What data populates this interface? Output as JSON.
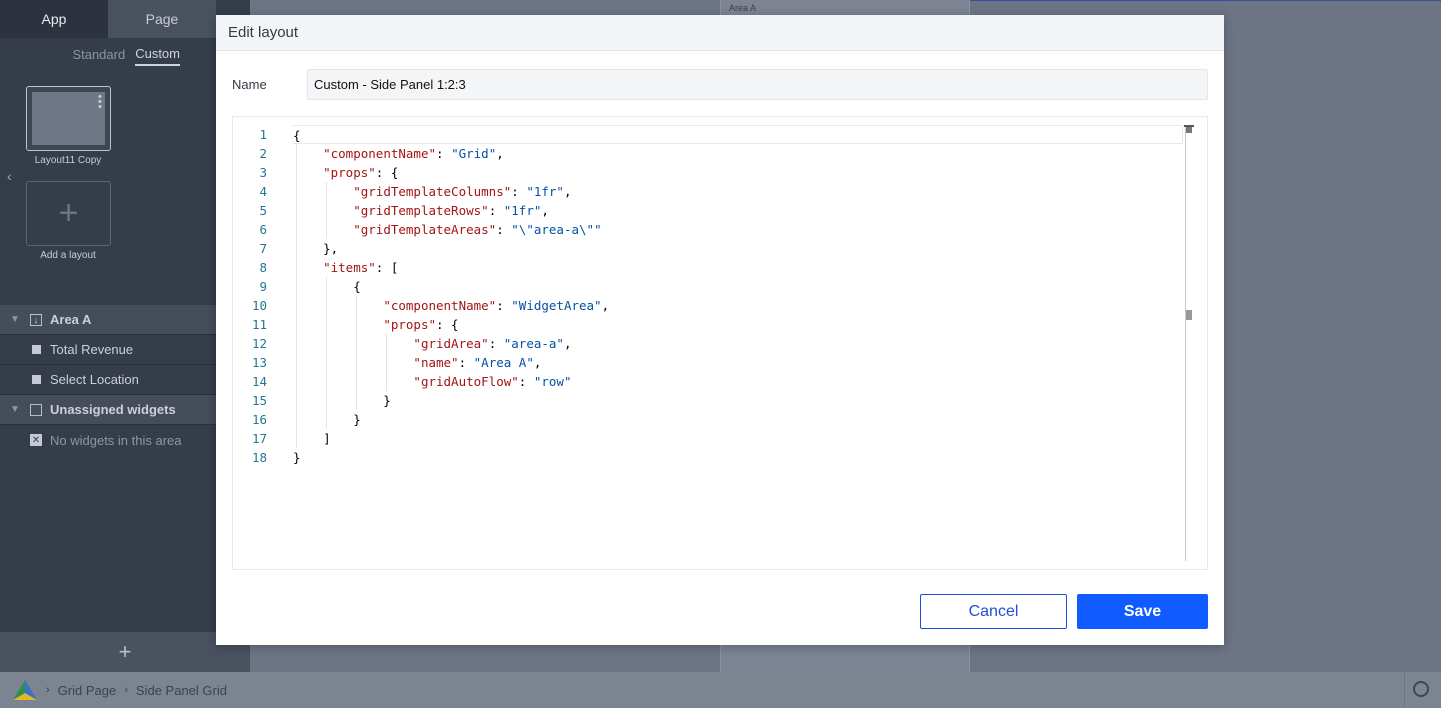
{
  "left_panel": {
    "tabs": [
      {
        "label": "App"
      },
      {
        "label": "Page"
      }
    ],
    "subtabs": [
      {
        "label": "Standard"
      },
      {
        "label": "Custom"
      }
    ],
    "layout_card_label": "Layout11 Copy",
    "add_layout_label": "Add a layout",
    "add_icon": "+",
    "tree": {
      "area_group": "Area A",
      "area_items": [
        "Total Revenue",
        "Select Location"
      ],
      "unassigned_group": "Unassigned widgets",
      "unassigned_empty": "No widgets in this area"
    },
    "bottom_add_icon": "+"
  },
  "canvas": {
    "area_label": "Area A"
  },
  "statusbar": {
    "breadcrumb": [
      "Grid Page",
      "Side Panel Grid"
    ],
    "separator": "›"
  },
  "modal": {
    "title": "Edit layout",
    "name_label": "Name",
    "name_value": "Custom - Side Panel 1:2:3",
    "cancel_label": "Cancel",
    "save_label": "Save",
    "code_lines": [
      [
        {
          "t": "p",
          "s": "{"
        }
      ],
      [
        {
          "t": "p",
          "s": "    "
        },
        {
          "t": "k",
          "s": "\"componentName\""
        },
        {
          "t": "p",
          "s": ": "
        },
        {
          "t": "v",
          "s": "\"Grid\""
        },
        {
          "t": "p",
          "s": ","
        }
      ],
      [
        {
          "t": "p",
          "s": "    "
        },
        {
          "t": "k",
          "s": "\"props\""
        },
        {
          "t": "p",
          "s": ": {"
        }
      ],
      [
        {
          "t": "p",
          "s": "        "
        },
        {
          "t": "k",
          "s": "\"gridTemplateColumns\""
        },
        {
          "t": "p",
          "s": ": "
        },
        {
          "t": "v",
          "s": "\"1fr\""
        },
        {
          "t": "p",
          "s": ","
        }
      ],
      [
        {
          "t": "p",
          "s": "        "
        },
        {
          "t": "k",
          "s": "\"gridTemplateRows\""
        },
        {
          "t": "p",
          "s": ": "
        },
        {
          "t": "v",
          "s": "\"1fr\""
        },
        {
          "t": "p",
          "s": ","
        }
      ],
      [
        {
          "t": "p",
          "s": "        "
        },
        {
          "t": "k",
          "s": "\"gridTemplateAreas\""
        },
        {
          "t": "p",
          "s": ": "
        },
        {
          "t": "v",
          "s": "\"\\\"area-a\\\"\""
        }
      ],
      [
        {
          "t": "p",
          "s": "    },"
        }
      ],
      [
        {
          "t": "p",
          "s": "    "
        },
        {
          "t": "k",
          "s": "\"items\""
        },
        {
          "t": "p",
          "s": ": ["
        }
      ],
      [
        {
          "t": "p",
          "s": "        {"
        }
      ],
      [
        {
          "t": "p",
          "s": "            "
        },
        {
          "t": "k",
          "s": "\"componentName\""
        },
        {
          "t": "p",
          "s": ": "
        },
        {
          "t": "v",
          "s": "\"WidgetArea\""
        },
        {
          "t": "p",
          "s": ","
        }
      ],
      [
        {
          "t": "p",
          "s": "            "
        },
        {
          "t": "k",
          "s": "\"props\""
        },
        {
          "t": "p",
          "s": ": {"
        }
      ],
      [
        {
          "t": "p",
          "s": "                "
        },
        {
          "t": "k",
          "s": "\"gridArea\""
        },
        {
          "t": "p",
          "s": ": "
        },
        {
          "t": "v",
          "s": "\"area-a\""
        },
        {
          "t": "p",
          "s": ","
        }
      ],
      [
        {
          "t": "p",
          "s": "                "
        },
        {
          "t": "k",
          "s": "\"name\""
        },
        {
          "t": "p",
          "s": ": "
        },
        {
          "t": "v",
          "s": "\"Area A\""
        },
        {
          "t": "p",
          "s": ","
        }
      ],
      [
        {
          "t": "p",
          "s": "                "
        },
        {
          "t": "k",
          "s": "\"gridAutoFlow\""
        },
        {
          "t": "p",
          "s": ": "
        },
        {
          "t": "v",
          "s": "\"row\""
        }
      ],
      [
        {
          "t": "p",
          "s": "            }"
        }
      ],
      [
        {
          "t": "p",
          "s": "        }"
        }
      ],
      [
        {
          "t": "p",
          "s": "    ]"
        }
      ],
      [
        {
          "t": "p",
          "s": "}"
        }
      ]
    ]
  }
}
